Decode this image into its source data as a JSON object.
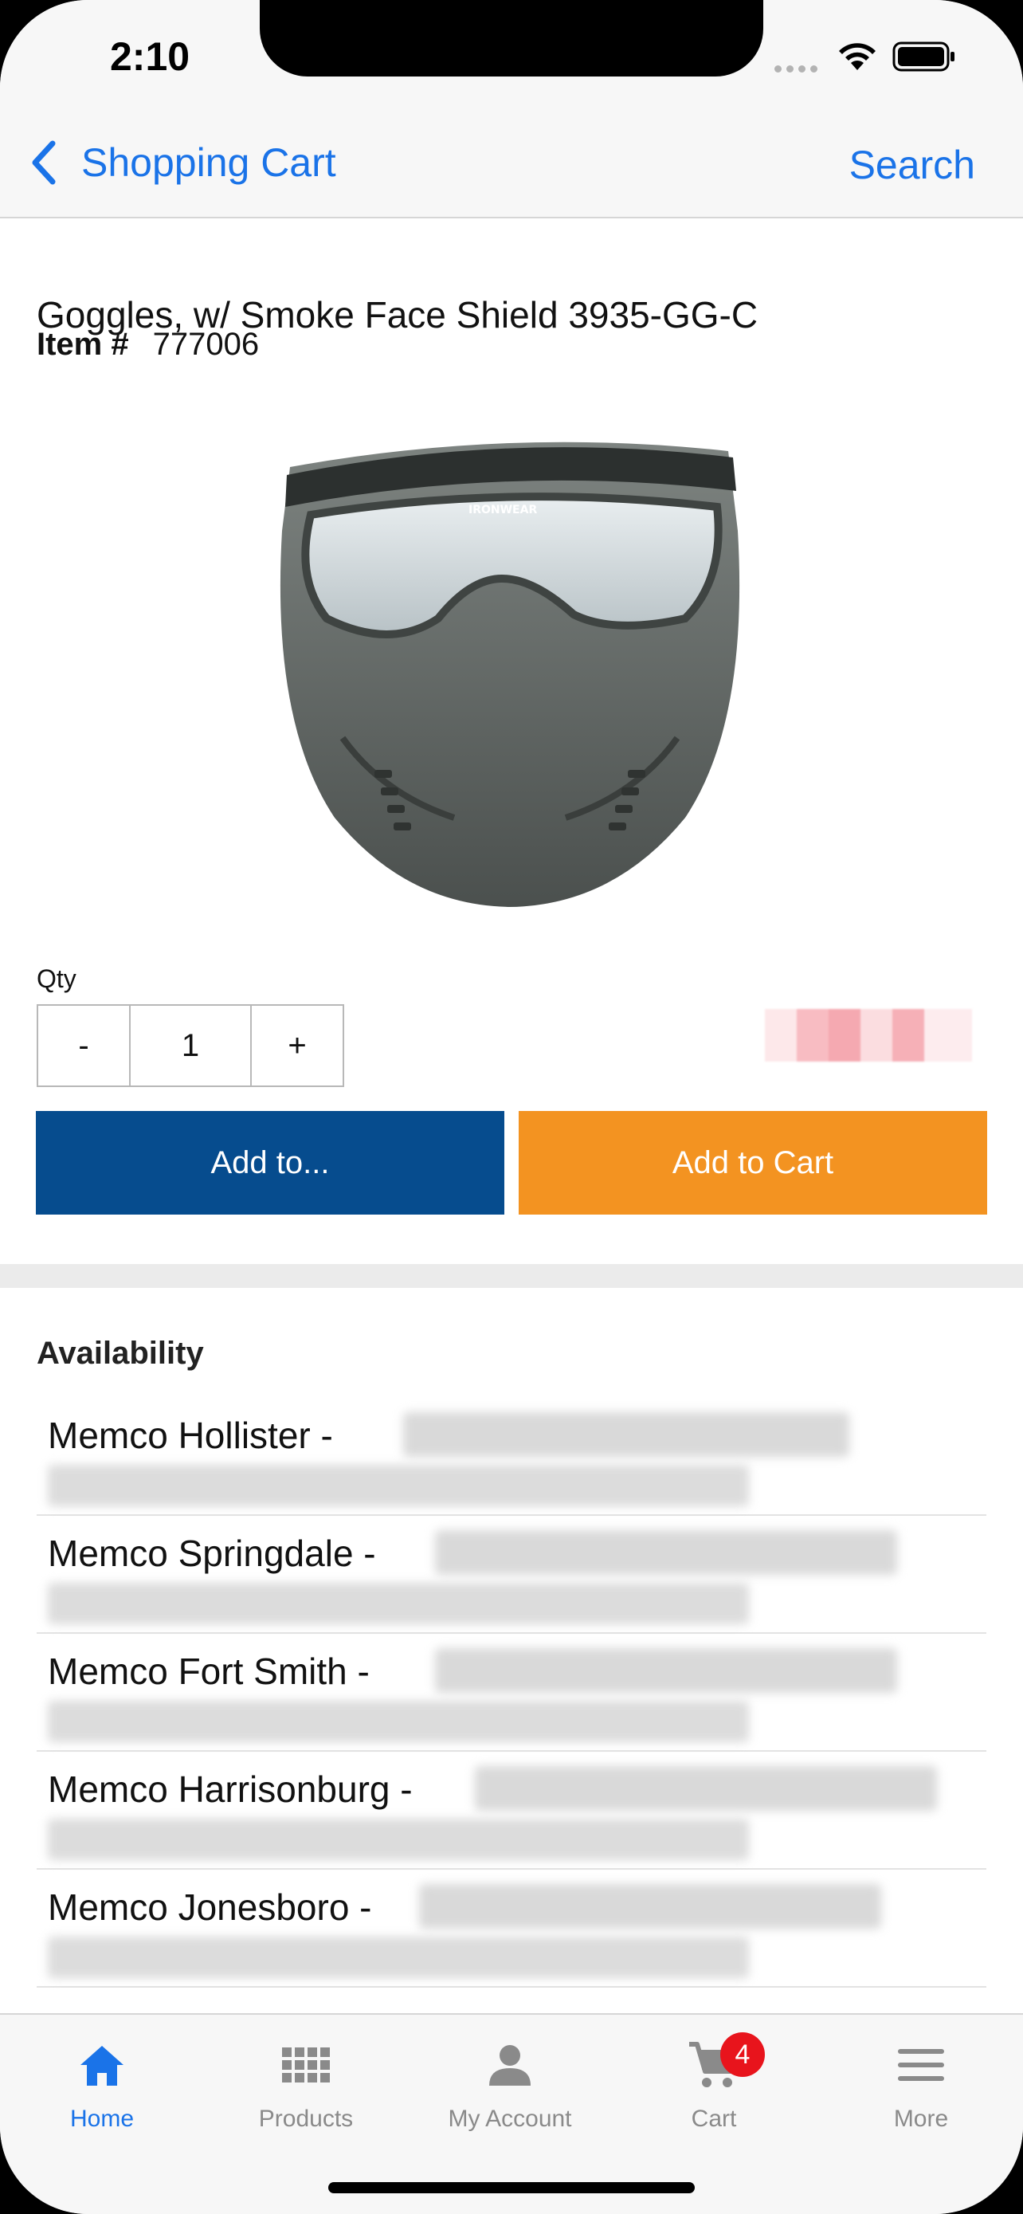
{
  "status_bar": {
    "time": "2:10"
  },
  "nav": {
    "back_label": "Shopping Cart",
    "search_label": "Search"
  },
  "product": {
    "title": "Goggles, w/ Smoke Face Shield 3935-GG-C",
    "item_label": "Item #",
    "item_number": "777006",
    "image_label": "IRONWEAR"
  },
  "quantity": {
    "label": "Qty",
    "minus": "-",
    "value": "1",
    "plus": "+"
  },
  "buttons": {
    "add_to": "Add to...",
    "add_to_cart": "Add to Cart"
  },
  "availability": {
    "title": "Availability",
    "locations": [
      "Memco Hollister -",
      "Memco Springdale -",
      "Memco Fort Smith -",
      "Memco Harrisonburg -",
      "Memco Jonesboro -"
    ]
  },
  "tabbar": {
    "tabs": [
      {
        "label": "Home",
        "icon": "home-icon",
        "active": true
      },
      {
        "label": "Products",
        "icon": "grid-icon",
        "active": false
      },
      {
        "label": "My Account",
        "icon": "person-icon",
        "active": false
      },
      {
        "label": "Cart",
        "icon": "cart-icon",
        "active": false,
        "badge": "4"
      },
      {
        "label": "More",
        "icon": "menu-icon",
        "active": false
      }
    ]
  },
  "colors": {
    "link_blue": "#1a73e8",
    "add_to_button": "#064c8e",
    "add_to_cart_button": "#f39321",
    "badge_red": "#e8141c"
  }
}
